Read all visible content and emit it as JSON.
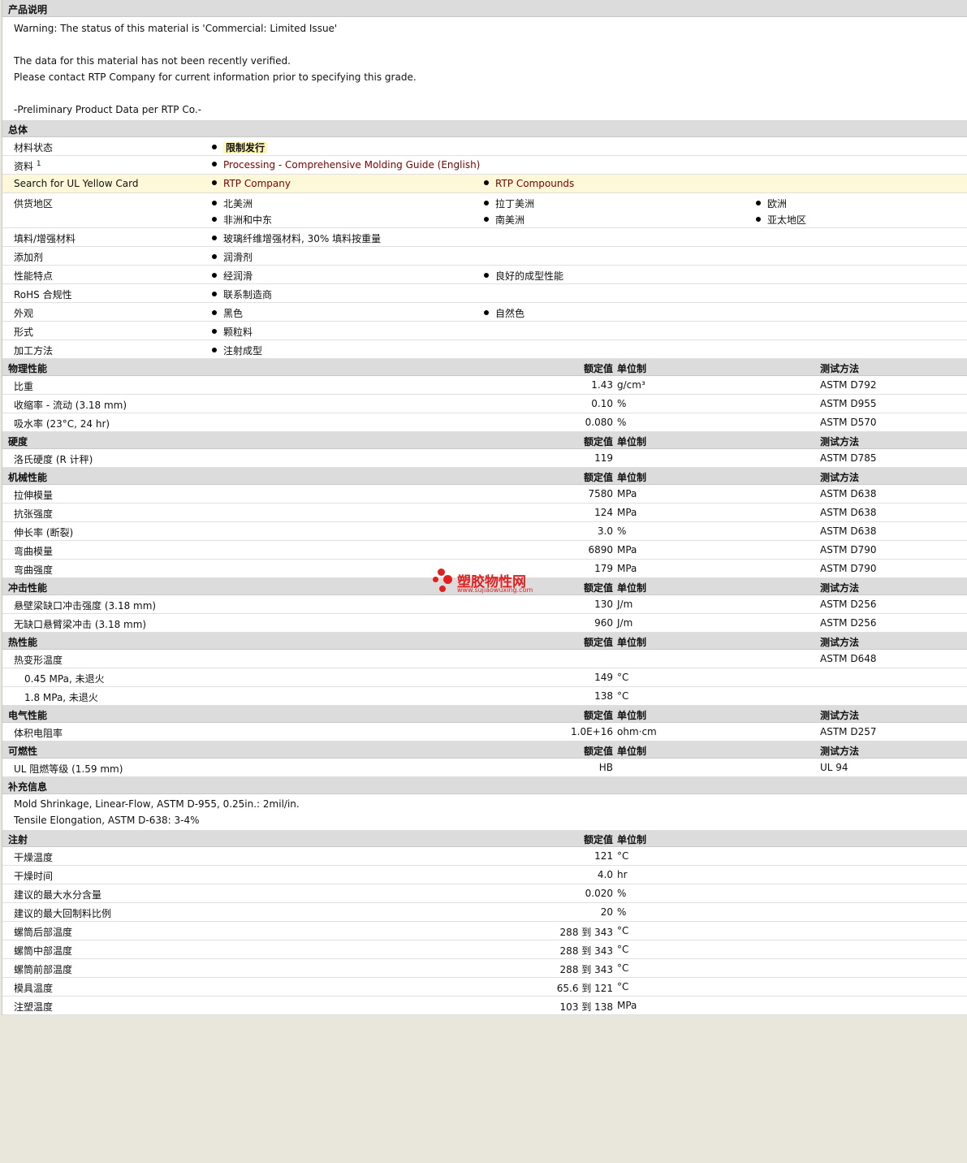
{
  "desc": {
    "title": "产品说明",
    "lines": [
      "Warning: The status of this material is 'Commercial: Limited Issue'",
      "",
      "The data for this material has not been recently verified.",
      "Please contact RTP Company for current information prior to specifying this grade.",
      "",
      "-Preliminary Product Data per RTP Co.-"
    ]
  },
  "general": {
    "title": "总体",
    "status_label": "材料状态",
    "status_value": "限制发行",
    "docs_label": "资料",
    "docs_sup": "1",
    "docs_link": "Processing - Comprehensive Molding Guide (English)",
    "ul_label": "Search for UL Yellow Card",
    "ul_link1": "RTP Company",
    "ul_link2": "RTP Compounds",
    "region_label": "供货地区",
    "regions": [
      "北美洲",
      "拉丁美洲",
      "欧洲",
      "非洲和中东",
      "南美洲",
      "亚太地区"
    ],
    "filler_label": "填料/增强材料",
    "filler_value": "玻璃纤维增强材料, 30% 填料按重量",
    "additive_label": "添加剂",
    "additive_value": "润滑剂",
    "feature_label": "性能特点",
    "features": [
      "经润滑",
      "良好的成型性能"
    ],
    "rohs_label": "RoHS 合规性",
    "rohs_value": "联系制造商",
    "appearance_label": "外观",
    "appearances": [
      "黑色",
      "自然色"
    ],
    "form_label": "形式",
    "form_value": "颗粒料",
    "process_label": "加工方法",
    "process_value": "注射成型"
  },
  "headers": {
    "value": "额定值",
    "unit": "单位制",
    "method": "测试方法"
  },
  "sections": [
    {
      "title": "物理性能",
      "rows": [
        {
          "label": "比重",
          "value": "1.43",
          "unit": "g/cm³",
          "method": "ASTM D792"
        },
        {
          "label": "收缩率  - 流动  (3.18 mm)",
          "value": "0.10",
          "unit": "%",
          "method": "ASTM D955"
        },
        {
          "label": "吸水率  (23°C, 24 hr)",
          "value": "0.080",
          "unit": "%",
          "method": "ASTM D570"
        }
      ]
    },
    {
      "title": "硬度",
      "rows": [
        {
          "label": "洛氏硬度  (R 计秤)",
          "value": "119",
          "unit": "",
          "method": "ASTM D785"
        }
      ]
    },
    {
      "title": "机械性能",
      "rows": [
        {
          "label": "拉伸模量",
          "value": "7580",
          "unit": "MPa",
          "method": "ASTM D638"
        },
        {
          "label": "抗张强度",
          "value": "124",
          "unit": "MPa",
          "method": "ASTM D638"
        },
        {
          "label": "伸长率  (断裂)",
          "value": "3.0",
          "unit": "%",
          "method": "ASTM D638"
        },
        {
          "label": "弯曲模量",
          "value": "6890",
          "unit": "MPa",
          "method": "ASTM D790"
        },
        {
          "label": "弯曲强度",
          "value": "179",
          "unit": "MPa",
          "method": "ASTM D790"
        }
      ]
    },
    {
      "title": "冲击性能",
      "rows": [
        {
          "label": "悬壁梁缺口冲击强度  (3.18 mm)",
          "value": "130",
          "unit": "J/m",
          "method": "ASTM D256"
        },
        {
          "label": "无缺口悬臂梁冲击  (3.18 mm)",
          "value": "960",
          "unit": "J/m",
          "method": "ASTM D256"
        }
      ]
    },
    {
      "title": "热性能",
      "rows": [
        {
          "label": "热变形温度",
          "value": "",
          "unit": "",
          "method": "ASTM D648"
        },
        {
          "label": "0.45 MPa, 未退火",
          "value": "149",
          "unit": "°C",
          "method": "",
          "indent": true
        },
        {
          "label": "1.8 MPa, 未退火",
          "value": "138",
          "unit": "°C",
          "method": "",
          "indent": true
        }
      ]
    },
    {
      "title": "电气性能",
      "rows": [
        {
          "label": "体积电阻率",
          "value": "1.0E+16",
          "unit": "ohm·cm",
          "method": "ASTM D257"
        }
      ]
    },
    {
      "title": "可燃性",
      "rows": [
        {
          "label": "UL 阻燃等级  (1.59 mm)",
          "value": "HB",
          "unit": "",
          "method": "UL 94"
        }
      ]
    }
  ],
  "supplement": {
    "title": "补充信息",
    "lines": [
      "Mold Shrinkage, Linear-Flow, ASTM D-955, 0.25in.: 2mil/in.",
      "Tensile Elongation, ASTM D-638: 3-4%"
    ]
  },
  "injection": {
    "title": "注射",
    "rows": [
      {
        "label": "干燥温度",
        "value": "121",
        "unit": "°C"
      },
      {
        "label": "干燥时间",
        "value": "4.0",
        "unit": "hr"
      },
      {
        "label": "建议的最大水分含量",
        "value": "0.020",
        "unit": "%"
      },
      {
        "label": "建议的最大回制料比例",
        "value": "20",
        "unit": "%"
      },
      {
        "label": "螺筒后部温度",
        "value": "288 到  343",
        "unit": "°C"
      },
      {
        "label": "螺筒中部温度",
        "value": "288 到  343",
        "unit": "°C"
      },
      {
        "label": "螺筒前部温度",
        "value": "288 到  343",
        "unit": "°C"
      },
      {
        "label": "模具温度",
        "value": "65.6 到  121",
        "unit": "°C"
      },
      {
        "label": "注塑温度",
        "value": "103 到  138",
        "unit": "MPa"
      }
    ]
  },
  "watermark": {
    "name": "塑胶物性网",
    "url": "www.sujiaowuxing.com"
  }
}
